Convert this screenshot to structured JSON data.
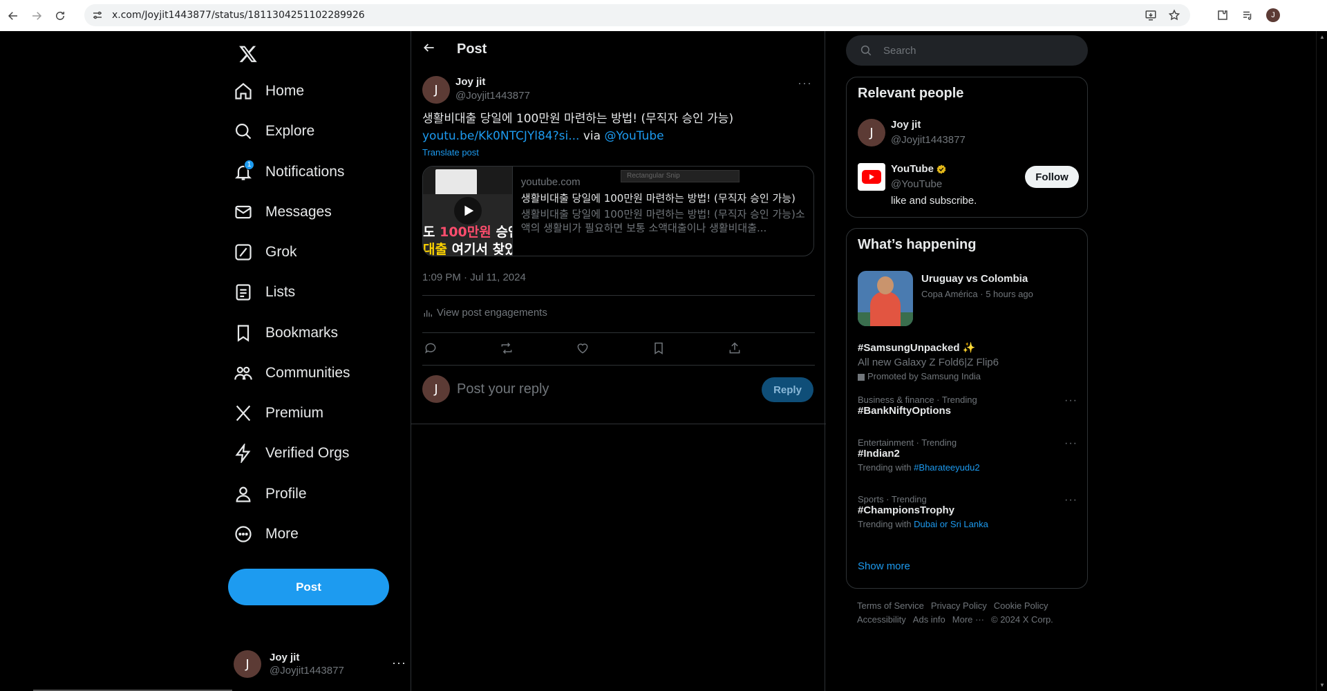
{
  "browser": {
    "url": "x.com/Joyjit1443877/status/1811304251102289926",
    "profile_initial": "J"
  },
  "nav": {
    "items": [
      {
        "label": "Home",
        "icon": "home-icon"
      },
      {
        "label": "Explore",
        "icon": "search-icon"
      },
      {
        "label": "Notifications",
        "icon": "bell-icon",
        "badge": "1"
      },
      {
        "label": "Messages",
        "icon": "mail-icon"
      },
      {
        "label": "Grok",
        "icon": "grok-icon"
      },
      {
        "label": "Lists",
        "icon": "list-icon"
      },
      {
        "label": "Bookmarks",
        "icon": "bookmark-icon"
      },
      {
        "label": "Communities",
        "icon": "communities-icon"
      },
      {
        "label": "Premium",
        "icon": "x-icon"
      },
      {
        "label": "Verified Orgs",
        "icon": "bolt-icon"
      },
      {
        "label": "Profile",
        "icon": "person-icon"
      },
      {
        "label": "More",
        "icon": "more-circle-icon"
      }
    ],
    "post_button": "Post",
    "account": {
      "initial": "J",
      "name": "Joy jit",
      "handle": "@Joyjit1443877",
      "menu": "···"
    }
  },
  "main": {
    "title": "Post",
    "tweet": {
      "initial": "J",
      "author": "Joy jit",
      "handle": "@Joyjit1443877",
      "menu": "···",
      "text": "생활비대출 당일에 100만원 마련하는 방법! (무직자 승인 가능)",
      "link": "youtu.be/Kk0NTCJYl84?si...",
      "via": " via ",
      "mention": "@YouTube",
      "translate": "Translate post",
      "card": {
        "thumb_line1_red": "100만원",
        "thumb_line1_pre": "도 ",
        "thumb_line1_post": " 승인",
        "thumb_line2_ylw": "대출",
        "thumb_line2_post": " 여기서 찾았",
        "snip_label": "Rectangular Snip",
        "domain": "youtube.com",
        "title": "생활비대출 당일에 100만원 마련하는 방법! (무직자 승인 가능)",
        "description": "생활비대출 당일에 100만원 마련하는 방법! (무직자 승인 가능)소액의 생활비가 필요하면 보통 소액대출이나 생활비대출..."
      },
      "timestamp": "1:09 PM · Jul 11, 2024",
      "engagements": "View post engagements"
    },
    "reply": {
      "initial": "J",
      "placeholder": "Post your reply",
      "button": "Reply"
    }
  },
  "right": {
    "search_placeholder": "Search",
    "relevant": {
      "title": "Relevant people",
      "people": [
        {
          "initial": "J",
          "name": "Joy jit",
          "handle": "@Joyjit1443877"
        },
        {
          "name": "YouTube",
          "handle": "@YouTube",
          "bio": "like and subscribe.",
          "follow": "Follow"
        }
      ]
    },
    "happening": {
      "title": "What’s happening",
      "featured": {
        "title": "Uruguay vs Colombia",
        "meta": "Copa América · 5 hours ago"
      },
      "promoted": {
        "tag": "#SamsungUnpacked",
        "emoji": "✨",
        "desc": "All new Galaxy Z Fold6|Z Flip6",
        "by": "Promoted by Samsung India"
      },
      "trends": [
        {
          "meta": "Business & finance · Trending",
          "tag": "#BankNiftyOptions",
          "sub_pre": "",
          "sub_link": ""
        },
        {
          "meta": "Entertainment · Trending",
          "tag": "#Indian2",
          "sub_pre": "Trending with ",
          "sub_link": "#Bharateeyudu2"
        },
        {
          "meta": "Sports · Trending",
          "tag": "#ChampionsTrophy",
          "sub_pre": "Trending with ",
          "sub_link": "Dubai or Sri Lanka"
        }
      ],
      "trend_menu": "···",
      "show_more": "Show more"
    },
    "footer": {
      "links": [
        "Terms of Service",
        "Privacy Policy",
        "Cookie Policy",
        "Accessibility",
        "Ads info",
        "More ···"
      ],
      "copyright": "© 2024 X Corp."
    }
  }
}
